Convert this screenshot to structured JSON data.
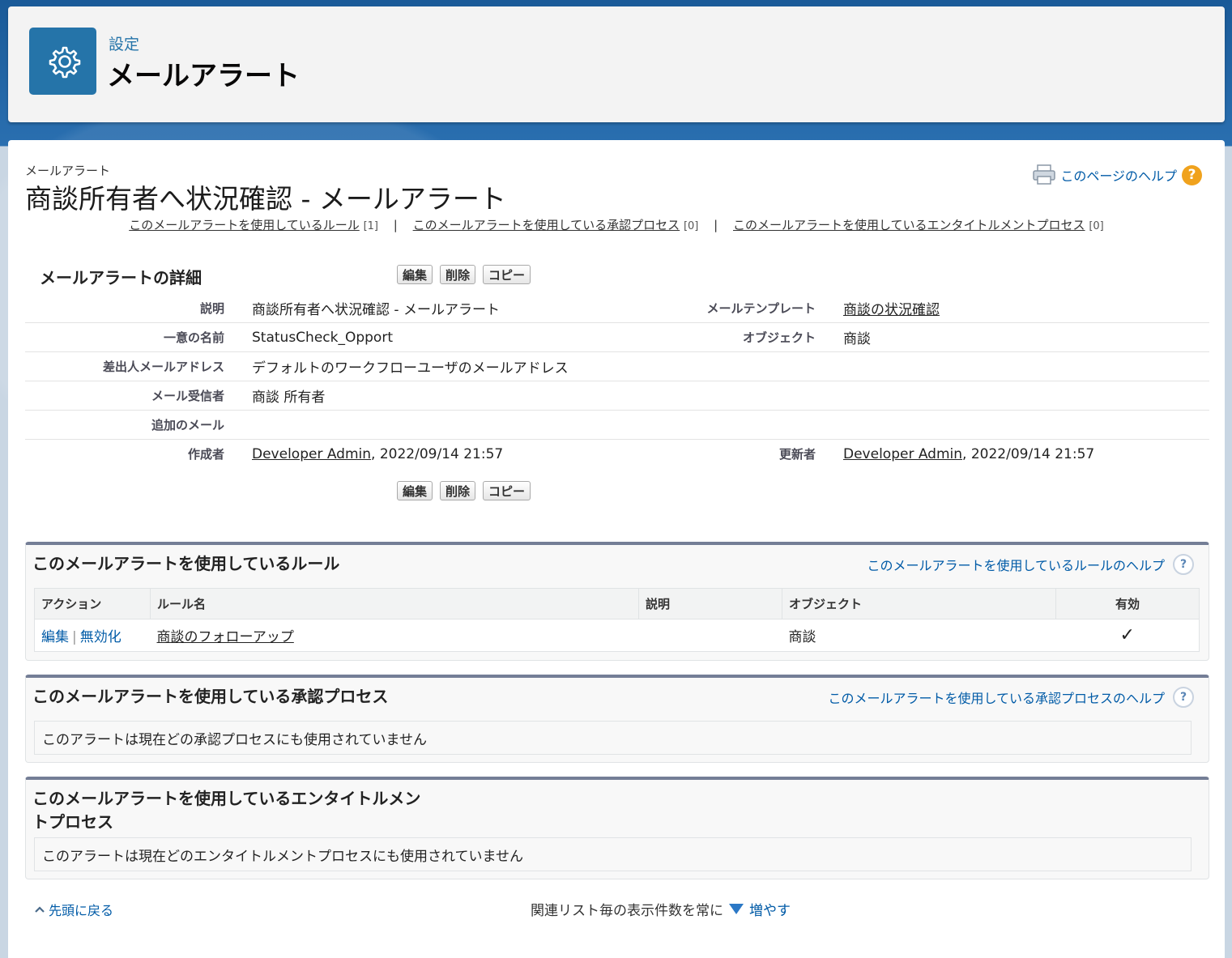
{
  "header": {
    "subtitle": "設定",
    "title": "メールアラート",
    "icon": "gear-icon"
  },
  "page": {
    "breadcrumb": "メールアラート",
    "title": "商談所有者へ状況確認 - メールアラート",
    "help_label": "このページのヘルプ"
  },
  "related_links": [
    {
      "label": "このメールアラートを使用しているルール",
      "count": "[1]"
    },
    {
      "label": "このメールアラートを使用している承認プロセス",
      "count": "[0]"
    },
    {
      "label": "このメールアラートを使用しているエンタイトルメントプロセス",
      "count": "[0]"
    }
  ],
  "detail": {
    "section_title": "メールアラートの詳細",
    "buttons": {
      "edit": "編集",
      "delete": "削除",
      "copy": "コピー"
    },
    "fields": {
      "description_label": "説明",
      "description_value": "商談所有者へ状況確認 - メールアラート",
      "template_label": "メールテンプレート",
      "template_value": "商談の状況確認",
      "unique_name_label": "一意の名前",
      "unique_name_value": "StatusCheck_Opport",
      "object_label": "オブジェクト",
      "object_value": "商談",
      "sender_label": "差出人メールアドレス",
      "sender_value": "デフォルトのワークフローユーザのメールアドレス",
      "recipients_label": "メール受信者",
      "recipients_value": "商談 所有者",
      "additional_label": "追加のメール",
      "additional_value": "",
      "created_label": "作成者",
      "created_user": "Developer Admin",
      "created_date": ", 2022/09/14 21:57",
      "modified_label": "更新者",
      "modified_user": "Developer Admin",
      "modified_date": ", 2022/09/14 21:57"
    }
  },
  "rules_section": {
    "title": "このメールアラートを使用しているルール",
    "help": "このメールアラートを使用しているルールのヘルプ",
    "columns": {
      "action": "アクション",
      "rule_name": "ルール名",
      "description": "説明",
      "object": "オブジェクト",
      "active": "有効"
    },
    "rows": [
      {
        "edit": "編集",
        "sep": "|",
        "deactivate": "無効化",
        "rule_name": "商談のフォローアップ",
        "description": "",
        "object": "商談",
        "active": "✓"
      }
    ]
  },
  "approval_section": {
    "title": "このメールアラートを使用している承認プロセス",
    "help": "このメールアラートを使用している承認プロセスのヘルプ",
    "empty": "このアラートは現在どの承認プロセスにも使用されていません"
  },
  "entitlement_section": {
    "title_line1": "このメールアラートを使用しているエンタイトルメン",
    "title_line2": "トプロセス",
    "empty": "このアラートは現在どのエンタイトルメントプロセスにも使用されていません"
  },
  "footer": {
    "back_to_top": "先頭に戻る",
    "more_prefix": "関連リスト毎の表示件数を常に",
    "more_link": "増やす"
  },
  "colors": {
    "link": "#015ba7",
    "header_icon_bg": "#2574a9",
    "help_badge": "#f0a21d"
  }
}
